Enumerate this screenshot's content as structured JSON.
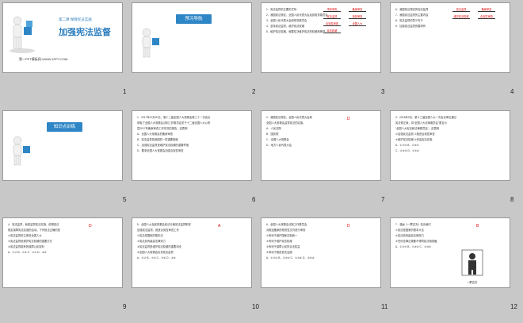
{
  "slides": [
    {
      "number": "1",
      "lesson": "第二课 保障宪法实施",
      "title": "加强宪法监督",
      "footer": "第一PPT模板网-WWW.1PPT.COM"
    },
    {
      "number": "2",
      "banner": "预习导航"
    },
    {
      "number": "3",
      "lines": [
        "1．宪法监督的主要形式有：",
        "2．我国宪法规定，全国人民代表大会及其常务委员会",
        "3．全国人民代表大会和常务委员会",
        "4．坚持宪法监督，维护宪法权威",
        "5．维护宪法权威，就要坚决维护宪法的权威和尊严。"
      ],
      "answers": [
        "事前审查",
        "备案审查",
        "宪法监督",
        "违宪审查",
        "合宪性审查",
        "全国人大",
        "宪法权威"
      ]
    },
    {
      "number": "4",
      "lines": [
        "6．我国宪法规定的宪法监督",
        "7．我国宪法监督的主要内容",
        "8．宪法监督的意义在于",
        "9．加强宪法监督的要求有"
      ],
      "answers": [
        "宪法监督",
        "备案审查",
        "维护宪法权威",
        "合宪性审查"
      ]
    },
    {
      "number": "5",
      "banner": "知识点训练"
    },
    {
      "number": "6",
      "lines": [
        "1．2017年12月20日，第十二届全国人大常委会第三十一次会议",
        "听取了全国人大常委会法制工作委员会关于十二届全国人大以来",
        "暨2017年备案审查工作情况的报告。这表明",
        "A．全国人大常委会的备案审查",
        "B．宪法监督是我国的一项重要制度",
        "C．加强宪法监督是维护宪法权威的重要举措",
        "D．要求全国人大常委会加强合宪性审查"
      ]
    },
    {
      "number": "7",
      "lines": [
        "2．我国宪法规定，全国人民代表大会和",
        "全国人大常委会监督宪法的实施。",
        "A．人民法院",
        "B．国务院",
        "C．全国人大常委会",
        "D．地方人民代表大会"
      ],
      "answer": "D"
    },
    {
      "number": "8",
      "lines": [
        "3．2018年3月，第十三届全国人大一次会议审议通过",
        "宪法修正案，将“全国人大法律委员会”更名为",
        "“全国人大宪法和法律委员会”。这表明",
        "①加强宪法监督 ②推进合宪性审查",
        "③维护宪法权威 ④完善宪法实施",
        "A．①②③  B．①③④",
        "C．②③④  D．①②④"
      ]
    },
    {
      "number": "9",
      "lines": [
        "4．宪法监督，就是监督宪法实施，依照宪法",
        "规定保障宪法实施的活动。下列说法正确的是",
        "①宪法监督的主体是全国人大",
        "②宪法监督是维护宪法权威的重要方式",
        "③宪法监督能有效保障公民权利",
        "A．①② B．①③ C．②③ D．③④"
      ],
      "answer": "D"
    },
    {
      "number": "10",
      "lines": [
        "5．全国人大及其常委会依法行使宪法监督职权",
        "加强宪法监督，推进合宪性审查工作",
        "①宪法是国家的根本法",
        "②宪法具有最高法律效力",
        "③宪法监督是维护宪法权威的重要手段",
        "④全国人大常委会负责宪法监督",
        "A．①② B．①③ C．②④ D．③④"
      ],
      "answer": "A"
    },
    {
      "number": "11",
      "lines": [
        "6．全国人大常委会法制工作委员会",
        "对报送备案的规范性文件进行审查",
        "①有利于维护国家法制统一",
        "②有利于维护宪法权威",
        "③有利于保障公民的合法权益",
        "④有利于推进依法治国",
        "A．①②③ B．①②④ C．①③④ D．②③④"
      ],
      "answer": "D"
    },
    {
      "number": "12",
      "lines": [
        "7．漫画《一票否决》告诉我们",
        "①宪法是国家的根本大法",
        "②宪法具有最高法律效力",
        "③任何法律法规都不得同宪法相抵触",
        "A．①②③ B．①③④ C．②③④"
      ],
      "answer": "B",
      "caption": "一票否决"
    }
  ],
  "colors": {
    "accent": "#2f86c6",
    "answer": "#dd0000",
    "background": "#c8c8c8"
  }
}
